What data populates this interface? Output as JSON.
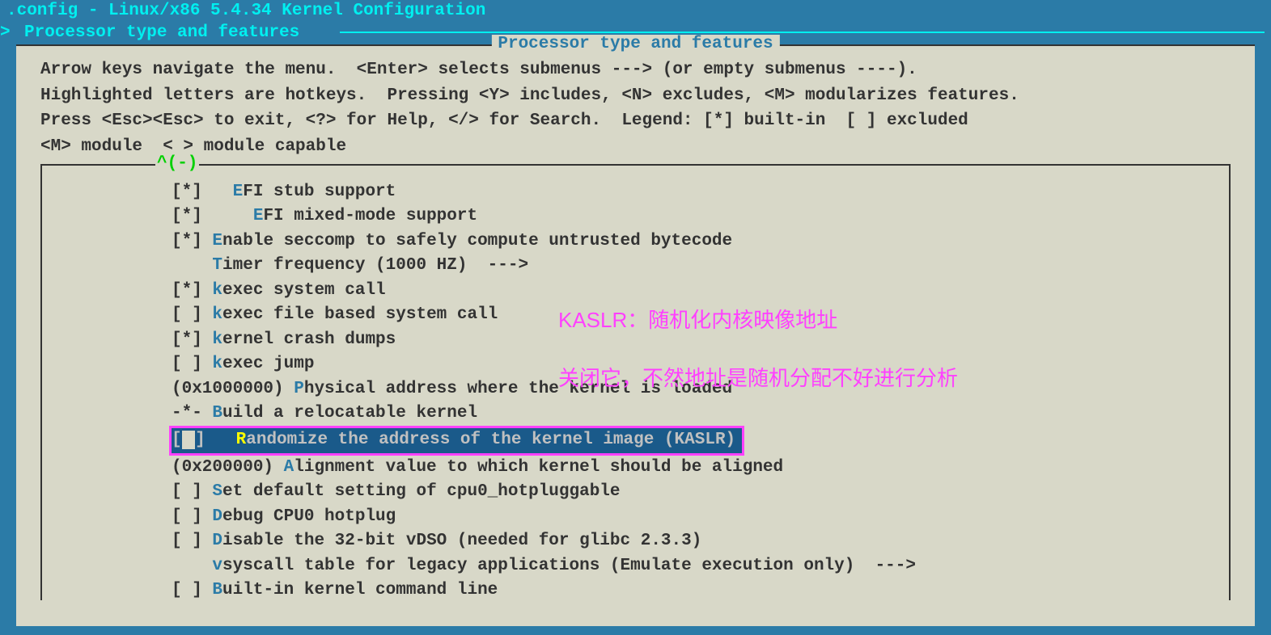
{
  "title": ".config - Linux/x86 5.4.34 Kernel Configuration",
  "breadcrumb": {
    "arrow": ">",
    "text": "Processor type and features"
  },
  "panel_title": "Processor type and features",
  "help": "Arrow keys navigate the menu.  <Enter> selects submenus ---> (or empty submenus ----).\nHighlighted letters are hotkeys.  Pressing <Y> includes, <N> excludes, <M> modularizes features.\nPress <Esc><Esc> to exit, <?> for Help, </> for Search.  Legend: [*] built-in  [ ] excluded\n<M> module  < > module capable",
  "scroll_indicator": "^(-)",
  "menu": [
    {
      "prefix": "[*]   ",
      "hk": "E",
      "label": "FI stub support"
    },
    {
      "prefix": "[*]     ",
      "hk": "E",
      "label": "FI mixed-mode support"
    },
    {
      "prefix": "[*] ",
      "hk": "E",
      "label": "nable seccomp to safely compute untrusted bytecode"
    },
    {
      "prefix": "    ",
      "hk": "T",
      "label": "imer frequency (1000 HZ)  --->"
    },
    {
      "prefix": "[*] ",
      "hk": "k",
      "label": "exec system call"
    },
    {
      "prefix": "[ ] ",
      "hk": "k",
      "label": "exec file based system call"
    },
    {
      "prefix": "[*] ",
      "hk": "k",
      "label": "ernel crash dumps"
    },
    {
      "prefix": "[ ] ",
      "hk": "k",
      "label": "exec jump"
    },
    {
      "prefix": "(0x1000000) ",
      "hk": "P",
      "label": "hysical address where the kernel is loaded"
    },
    {
      "prefix": "-*- ",
      "hk": "B",
      "label": "uild a relocatable kernel"
    },
    {
      "selected": true,
      "prefix_a": "[",
      "prefix_b": "]   ",
      "hk": "R",
      "label": "andomize the address of the kernel image (KASLR)"
    },
    {
      "prefix": "(0x200000) ",
      "hk": "A",
      "label": "lignment value to which kernel should be aligned"
    },
    {
      "prefix": "[ ] ",
      "hk": "S",
      "label": "et default setting of cpu0_hotpluggable"
    },
    {
      "prefix": "[ ] ",
      "hk": "D",
      "label": "ebug CPU0 hotplug"
    },
    {
      "prefix": "[ ] ",
      "hk": "D",
      "label": "isable the 32-bit vDSO (needed for glibc 2.3.3)"
    },
    {
      "prefix": "    ",
      "hk": "v",
      "label": "syscall table for legacy applications (Emulate execution only)  --->"
    },
    {
      "prefix": "[ ] ",
      "hk": "B",
      "label": "uilt-in kernel command line"
    }
  ],
  "annotations": {
    "line1": "KASLR：随机化内核映像地址",
    "line2": "关闭它，不然地址是随机分配不好进行分析"
  }
}
